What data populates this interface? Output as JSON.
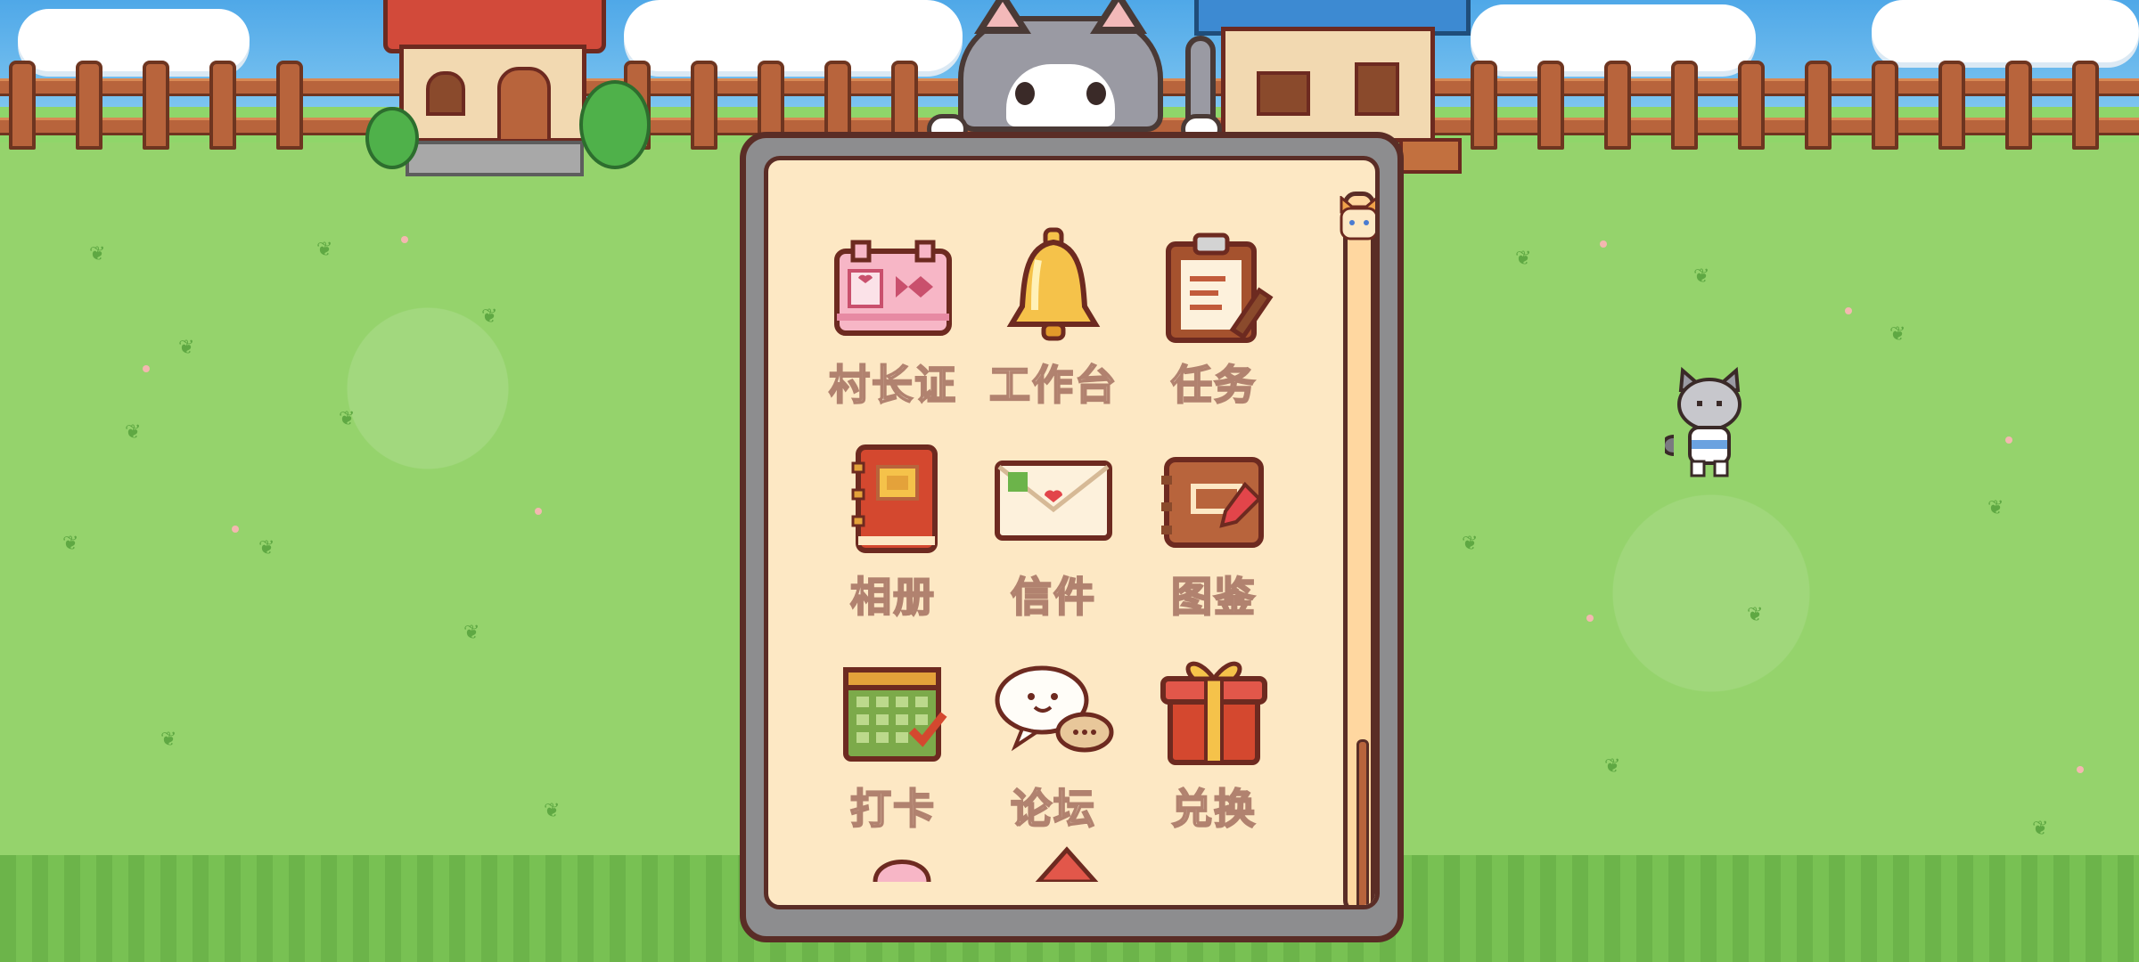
{
  "menu": {
    "items": [
      {
        "label": "村长证",
        "icon": "mayor-card-icon"
      },
      {
        "label": "工作台",
        "icon": "bell-icon"
      },
      {
        "label": "任务",
        "icon": "task-clipboard-icon"
      },
      {
        "label": "相册",
        "icon": "photo-album-icon"
      },
      {
        "label": "信件",
        "icon": "letter-icon"
      },
      {
        "label": "图鉴",
        "icon": "encyclopedia-icon"
      },
      {
        "label": "打卡",
        "icon": "check-in-calendar-icon"
      },
      {
        "label": "论坛",
        "icon": "forum-chat-icon"
      },
      {
        "label": "兑换",
        "icon": "gift-exchange-icon"
      }
    ]
  },
  "colors": {
    "panel_bg": "#fde8c4",
    "panel_border": "#5a2d26",
    "label_fill": "#f7e6cc",
    "label_stroke": "#b1826f",
    "grass": "#95d36c"
  }
}
